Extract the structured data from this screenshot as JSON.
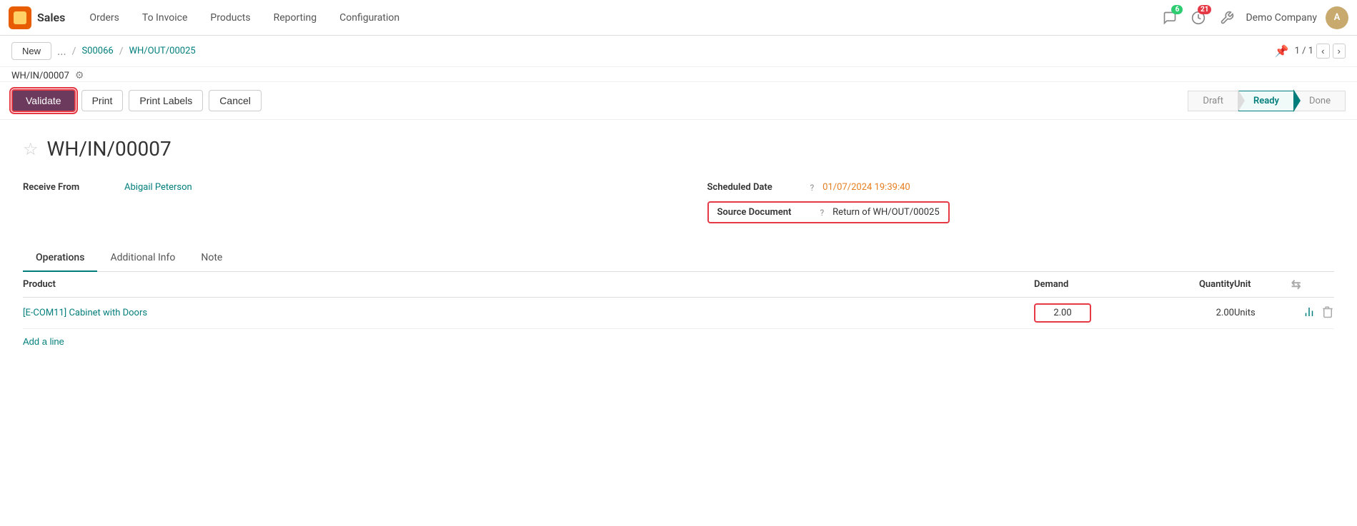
{
  "app": {
    "logo_color": "#e85d04",
    "brand": "Sales"
  },
  "topnav": {
    "items": [
      "Orders",
      "To Invoice",
      "Products",
      "Reporting",
      "Configuration"
    ],
    "notifications_count": "6",
    "tasks_count": "21",
    "company": "Demo Company"
  },
  "breadcrumb": {
    "new_label": "New",
    "dots": "...",
    "link1": "S00066",
    "link2": "WH/OUT/00025",
    "current": "WH/IN/00007",
    "page_info": "1 / 1"
  },
  "actions": {
    "validate": "Validate",
    "print": "Print",
    "print_labels": "Print Labels",
    "cancel": "Cancel"
  },
  "status": {
    "steps": [
      "Draft",
      "Ready",
      "Done"
    ],
    "active": "Ready"
  },
  "record": {
    "title": "WH/IN/00007",
    "receive_from_label": "Receive From",
    "receive_from_value": "Abigail Peterson",
    "scheduled_date_label": "Scheduled Date",
    "scheduled_date_value": "01/07/2024 19:39:40",
    "source_document_label": "Source Document",
    "source_document_value": "Return of WH/OUT/00025"
  },
  "tabs": [
    "Operations",
    "Additional Info",
    "Note"
  ],
  "active_tab": "Operations",
  "table": {
    "headers": {
      "product": "Product",
      "demand": "Demand",
      "quantity": "Quantity",
      "unit": "Unit"
    },
    "rows": [
      {
        "product": "[E-COM11] Cabinet with Doors",
        "demand": "2.00",
        "quantity": "2.00",
        "unit": "Units"
      }
    ],
    "add_line": "Add a line"
  }
}
